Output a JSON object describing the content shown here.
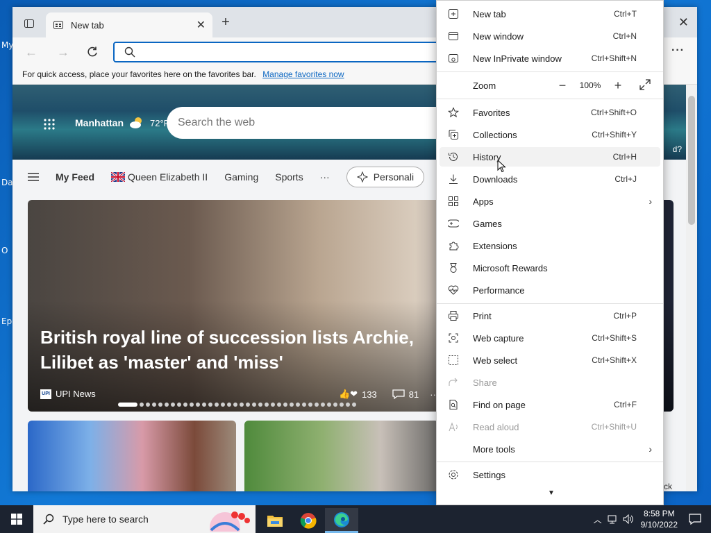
{
  "desktop": {
    "labels": [
      "My",
      "Da",
      "O",
      "Ep"
    ]
  },
  "browser": {
    "tab_title": "New tab",
    "favbar_text": "For quick access, place your favorites here on the favorites bar.",
    "favbar_link": "Manage favorites now",
    "address_value": ""
  },
  "newtab_page": {
    "location": "Manhattan",
    "temperature": "72°F",
    "search_placeholder": "Search the web",
    "feed": {
      "my_feed": "My Feed",
      "topics": [
        "Queen Elizabeth II",
        "Gaming",
        "Sports"
      ],
      "more": "···",
      "personalize": "Personali"
    },
    "headline": "British royal line of succession lists Archie, Lilibet as 'master' and 'miss'",
    "source": "UPI News",
    "source_logo": "UPI",
    "likes": "133",
    "comments": "81",
    "carousel_count": 36,
    "carousel_active": 0,
    "side_peek_text_1": "d?",
    "side_peek_text_2": "ack"
  },
  "menu": {
    "items": [
      {
        "icon": "new-tab-icon",
        "label": "New tab",
        "shortcut": "Ctrl+T"
      },
      {
        "icon": "new-window-icon",
        "label": "New window",
        "shortcut": "Ctrl+N"
      },
      {
        "icon": "inprivate-icon",
        "label": "New InPrivate window",
        "shortcut": "Ctrl+Shift+N"
      },
      {
        "label": "Zoom",
        "value": "100%"
      },
      {
        "icon": "star-icon",
        "label": "Favorites",
        "shortcut": "Ctrl+Shift+O"
      },
      {
        "icon": "collections-icon",
        "label": "Collections",
        "shortcut": "Ctrl+Shift+Y"
      },
      {
        "icon": "history-icon",
        "label": "History",
        "shortcut": "Ctrl+H"
      },
      {
        "icon": "download-icon",
        "label": "Downloads",
        "shortcut": "Ctrl+J"
      },
      {
        "icon": "apps-icon",
        "label": "Apps",
        "shortcut": ""
      },
      {
        "icon": "games-icon",
        "label": "Games",
        "shortcut": ""
      },
      {
        "icon": "extensions-icon",
        "label": "Extensions",
        "shortcut": ""
      },
      {
        "icon": "rewards-icon",
        "label": "Microsoft Rewards",
        "shortcut": ""
      },
      {
        "icon": "performance-icon",
        "label": "Performance",
        "shortcut": ""
      },
      {
        "icon": "print-icon",
        "label": "Print",
        "shortcut": "Ctrl+P"
      },
      {
        "icon": "web-capture-icon",
        "label": "Web capture",
        "shortcut": "Ctrl+Shift+S"
      },
      {
        "icon": "web-select-icon",
        "label": "Web select",
        "shortcut": "Ctrl+Shift+X"
      },
      {
        "icon": "share-icon",
        "label": "Share",
        "shortcut": ""
      },
      {
        "icon": "find-icon",
        "label": "Find on page",
        "shortcut": "Ctrl+F"
      },
      {
        "icon": "read-aloud-icon",
        "label": "Read aloud",
        "shortcut": "Ctrl+Shift+U"
      },
      {
        "label": "More tools",
        "shortcut": ""
      },
      {
        "icon": "settings-icon",
        "label": "Settings",
        "shortcut": ""
      }
    ],
    "hovered": "History",
    "disabled": [
      "Share",
      "Read aloud"
    ]
  },
  "taskbar": {
    "search_placeholder": "Type here to search",
    "time": "8:58 PM",
    "date": "9/10/2022"
  },
  "colors": {
    "accent": "#0a66c2",
    "desktop": "#1279d6",
    "taskbar": "#1c2330"
  }
}
